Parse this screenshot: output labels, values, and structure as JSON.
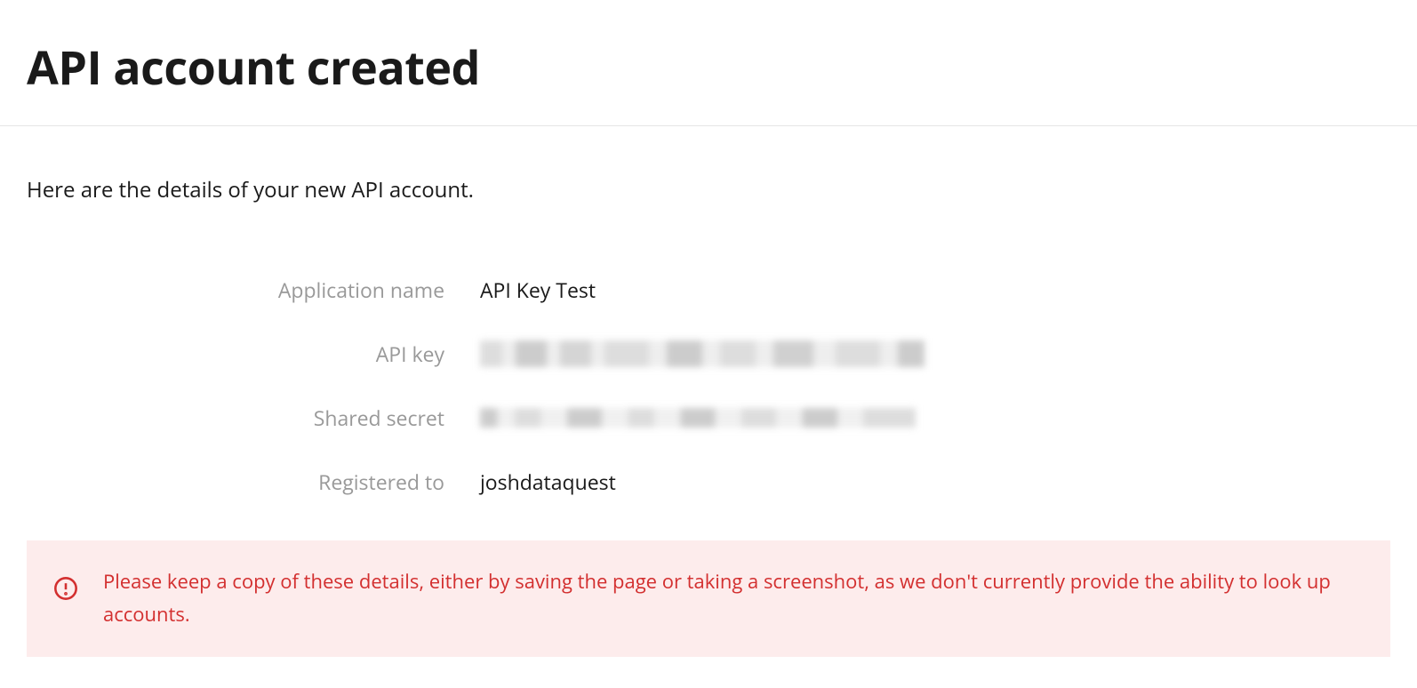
{
  "header": {
    "title": "API account created"
  },
  "content": {
    "intro": "Here are the details of your new API account.",
    "details": {
      "application_name": {
        "label": "Application name",
        "value": "API Key Test"
      },
      "api_key": {
        "label": "API key",
        "value_redacted": true
      },
      "shared_secret": {
        "label": "Shared secret",
        "value_redacted": true
      },
      "registered_to": {
        "label": "Registered to",
        "value": "joshdataquest"
      }
    }
  },
  "warning": {
    "icon": "alert-circle-icon",
    "text": "Please keep a copy of these details, either by saving the page or taking a screenshot, as we don't currently provide the ability to look up accounts."
  }
}
